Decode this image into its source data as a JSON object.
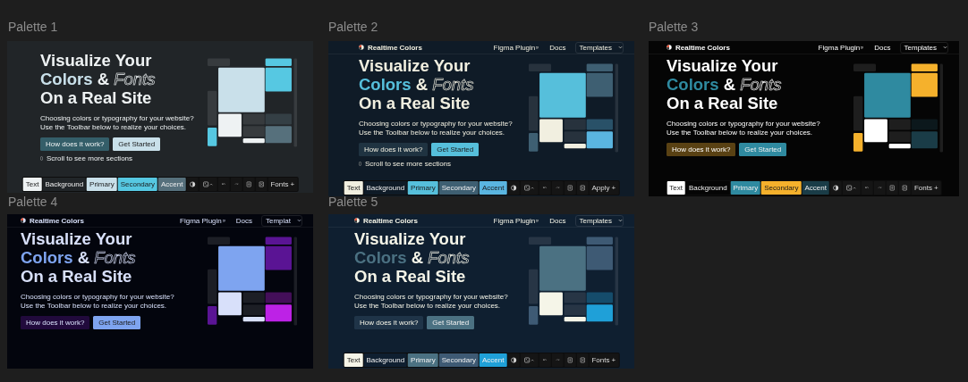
{
  "palettes": [
    {
      "label": "Palette 1",
      "colors": [
        {
          "color": "#eef2f3"
        },
        {
          "color": "#212528"
        },
        {
          "color": "#c9e0ea"
        },
        {
          "color": "#56c8e2"
        },
        {
          "color": "#56707c"
        }
      ],
      "hero": {
        "line_1": "Visualize Your",
        "highlight": "Colors",
        "ampersand": "&",
        "outline": "Fonts",
        "line_3": "On a Real Site",
        "text_1": "Choosing colors or typography for your website?",
        "text_2": "Use the Toolbar below to realize your choices.",
        "buttons": [
          "How does it work?",
          "Get Started"
        ],
        "scroll_hint": "Scroll to see more sections"
      },
      "toolbar": {
        "swatches": [
          "Text",
          "Background",
          "Primary",
          "Secondary",
          "Accent"
        ],
        "end_button": "Fonts +"
      }
    },
    {
      "label": "Palette 2",
      "colors": [
        {
          "color": "#f1efe0"
        },
        {
          "color": "#0f1b27"
        },
        {
          "color": "#56bfdb"
        },
        {
          "color": "#3e5f72"
        },
        {
          "color": "#5ab5e0"
        }
      ],
      "nav": {
        "brand": "Realtime Colors",
        "links": [
          "Figma Plugin",
          "Docs"
        ],
        "templates": "Templates"
      },
      "hero": {
        "line_1": "Visualize Your",
        "highlight": "Colors",
        "ampersand": "&",
        "outline": "Fonts",
        "line_3": "On a Real Site",
        "text_1": "Choosing colors or typography for your website?",
        "text_2": "Use the Toolbar below to realize your choices.",
        "buttons": [
          "How does it work?",
          "Get Started"
        ],
        "scroll_hint": "Scroll to see more sections"
      },
      "toolbar": {
        "swatches": [
          "Text",
          "Background",
          "Primary",
          "Secondary",
          "Accent"
        ],
        "end_button": "Apply +"
      }
    },
    {
      "label": "Palette 3",
      "colors": [
        {
          "color": "#ffffff"
        },
        {
          "color": "#050505"
        },
        {
          "color": "#2f8aa0"
        },
        {
          "color": "#f5b12c"
        },
        {
          "color": "#1a3c47"
        }
      ],
      "nav": {
        "brand": "Realtime Colors",
        "links": [
          "Figma Plugin",
          "Docs"
        ],
        "templates": "Templates"
      },
      "hero": {
        "line_1": "Visualize Your",
        "highlight": "Colors",
        "ampersand": "&",
        "outline": "Fonts",
        "line_3": "On a Real Site",
        "text_1": "Choosing colors or typography for your website?",
        "text_2": "Use the Toolbar below to realize your choices.",
        "buttons": [
          "How does it work?",
          "Get Started"
        ]
      },
      "toolbar": {
        "swatches": [
          "Text",
          "Background",
          "Primary",
          "Secondary",
          "Accent"
        ],
        "end_button": "Fonts +"
      }
    },
    {
      "label": "Palette 4",
      "colors": [
        {
          "color": "#d8e0fa"
        },
        {
          "color": "#03050d"
        },
        {
          "color": "#7ea4f0"
        },
        {
          "color": "#5a1494"
        },
        {
          "color": "#bd22e6"
        }
      ],
      "nav": {
        "brand": "Realtime Colors",
        "links": [
          "Figma Plugin",
          "Docs"
        ],
        "templates": "Templat"
      },
      "hero": {
        "line_1": "Visualize Your",
        "highlight": "Colors",
        "ampersand": "&",
        "outline": "Fonts",
        "line_3": "On a Real Site",
        "text_1": "Choosing colors or typography for your website?",
        "text_2": "Use the Toolbar below to realize your choices.",
        "buttons": [
          "How does it work?",
          "Get Started"
        ]
      }
    },
    {
      "label": "Palette 5",
      "colors": [
        {
          "color": "#f5f5e8"
        },
        {
          "color": "#0f1f30"
        },
        {
          "color": "#4b7182"
        },
        {
          "color": "#3e5a74"
        },
        {
          "color": "#1fa0d8"
        }
      ],
      "nav": {
        "brand": "Realtime Colors",
        "links": [
          "Figma Plugin",
          "Docs"
        ],
        "templates": "Templates"
      },
      "hero": {
        "line_1": "Visualize Your",
        "highlight": "Colors",
        "ampersand": "&",
        "outline": "Fonts",
        "line_3": "On a Real Site",
        "text_1": "Choosing colors or typography for your website?",
        "text_2": "Use the Toolbar below to realize your choices.",
        "buttons": [
          "How does it work?",
          "Get Started"
        ]
      },
      "toolbar": {
        "swatches": [
          "Text",
          "Background",
          "Primary",
          "Secondary",
          "Accent"
        ],
        "end_button": "Fonts +"
      }
    }
  ]
}
